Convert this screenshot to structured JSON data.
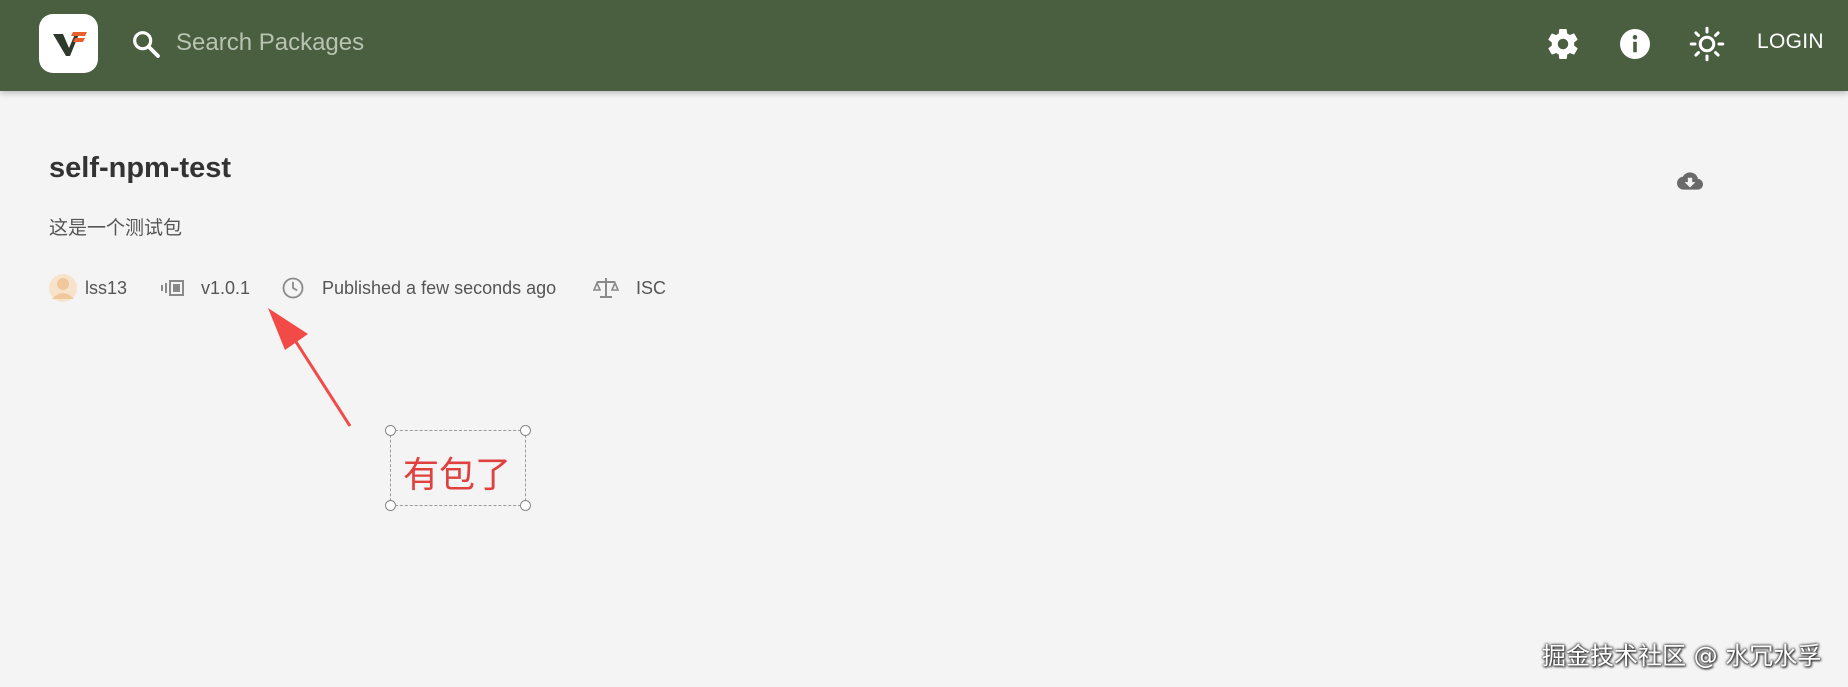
{
  "header": {
    "search_placeholder": "Search Packages",
    "login_label": "LOGIN",
    "icons": [
      "settings-icon",
      "info-icon",
      "theme-toggle-icon"
    ],
    "bar_color": "#4a5e40"
  },
  "package": {
    "name": "self-npm-test",
    "description": "这是一个测试包",
    "author": "lss13",
    "version": "v1.0.1",
    "published": "Published a few seconds ago",
    "license": "ISC"
  },
  "annotation": {
    "text": "有包了",
    "color": "#e0413f"
  },
  "watermark": "掘金技术社区 @ 水冗水孚"
}
